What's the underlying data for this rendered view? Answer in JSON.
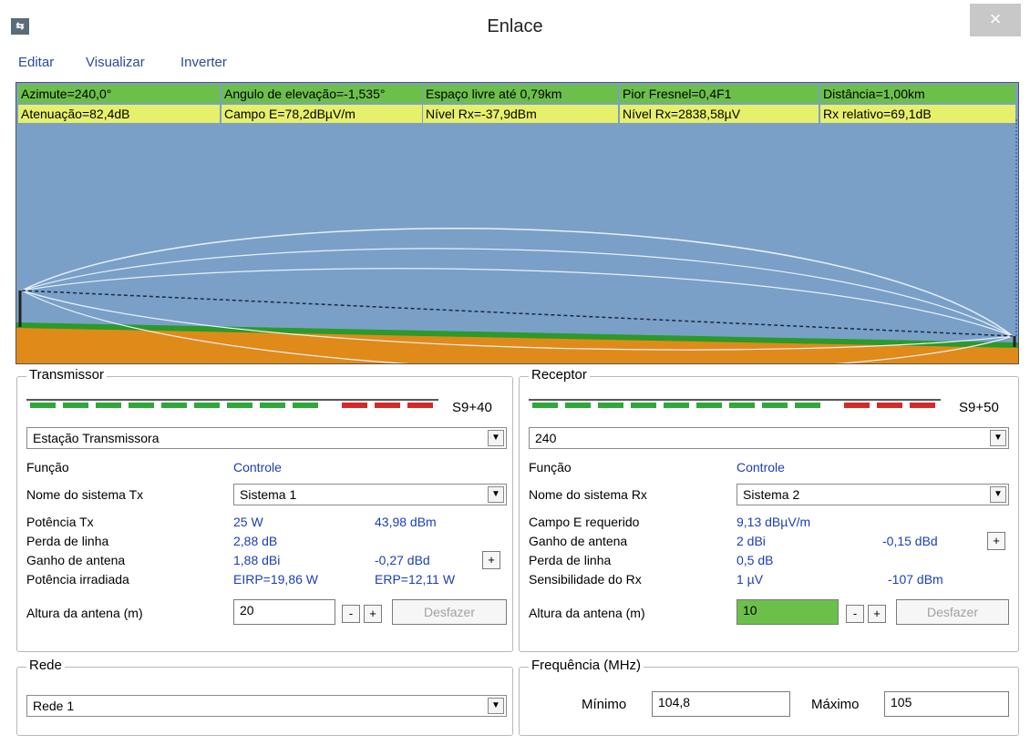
{
  "window": {
    "title": "Enlace",
    "icon": "app-link-icon",
    "close": "×"
  },
  "menu": [
    "Editar",
    "Visualizar",
    "Inverter"
  ],
  "profile": {
    "row1": [
      "Azimute=240,0°",
      "Angulo de elevação=-1,535°",
      "Espaço livre até 0,79km",
      "Pior Fresnel=0,4F1",
      "Distância=1,00km"
    ],
    "row2": [
      "Atenuação=82,4dB",
      "Campo E=78,2dBµV/m",
      "Nível Rx=-37,9dBm",
      "Nível Rx=2838,58µV",
      "Rx relativo=69,1dB"
    ],
    "colors": {
      "sky": "#7aa0c8",
      "ground": "#e08a1a",
      "vegetation": "#2a9a2a",
      "green_cell": "#6cc04a",
      "yellow_cell": "#e6f06a"
    }
  },
  "tx": {
    "legend": "Transmissor",
    "meter_label": "S9+40",
    "meter": {
      "green_segments": 9,
      "red_segments": 3
    },
    "station": "Estação Transmissora",
    "funcao_label": "Função",
    "funcao_value": "Controle",
    "sistema_label": "Nome do sistema Tx",
    "sistema_value": "Sistema  1",
    "potencia_label": "Potência Tx",
    "potencia_w": "25 W",
    "potencia_dbm": "43,98 dBm",
    "perda_label": "Perda de linha",
    "perda_value": "2,88 dB",
    "ganho_label": "Ganho de antena",
    "ganho_dbi": "1,88 dBi",
    "ganho_dbd": "-0,27 dBd",
    "irradiada_label": "Potência irradiada",
    "eirp": "EIRP=19,86 W",
    "erp": "ERP=12,11 W",
    "altura_label": "Altura da antena (m)",
    "altura_value": "20",
    "minus": "-",
    "plus": "+",
    "undo": "Desfazer"
  },
  "rx": {
    "legend": "Receptor",
    "meter_label": "S9+50",
    "meter": {
      "green_segments": 9,
      "red_segments": 3
    },
    "station": "240",
    "funcao_label": "Função",
    "funcao_value": "Controle",
    "sistema_label": "Nome do sistema Rx",
    "sistema_value": "Sistema  2",
    "campo_label": "Campo E requerido",
    "campo_value": "9,13 dBµV/m",
    "ganho_label": "Ganho de antena",
    "ganho_dbi": "2 dBi",
    "ganho_dbd": "-0,15 dBd",
    "perda_label": "Perda de linha",
    "perda_value": "0,5 dB",
    "sens_label": "Sensibilidade do Rx",
    "sens_uv": "1 µV",
    "sens_dbm": "-107 dBm",
    "altura_label": "Altura da antena (m)",
    "altura_value": "10",
    "minus": "-",
    "plus": "+",
    "undo": "Desfazer"
  },
  "rede": {
    "legend": "Rede",
    "value": "Rede 1"
  },
  "freq": {
    "legend": "Frequência (MHz)",
    "min_label": "Mínimo",
    "min_value": "104,8",
    "max_label": "Máximo",
    "max_value": "105"
  }
}
